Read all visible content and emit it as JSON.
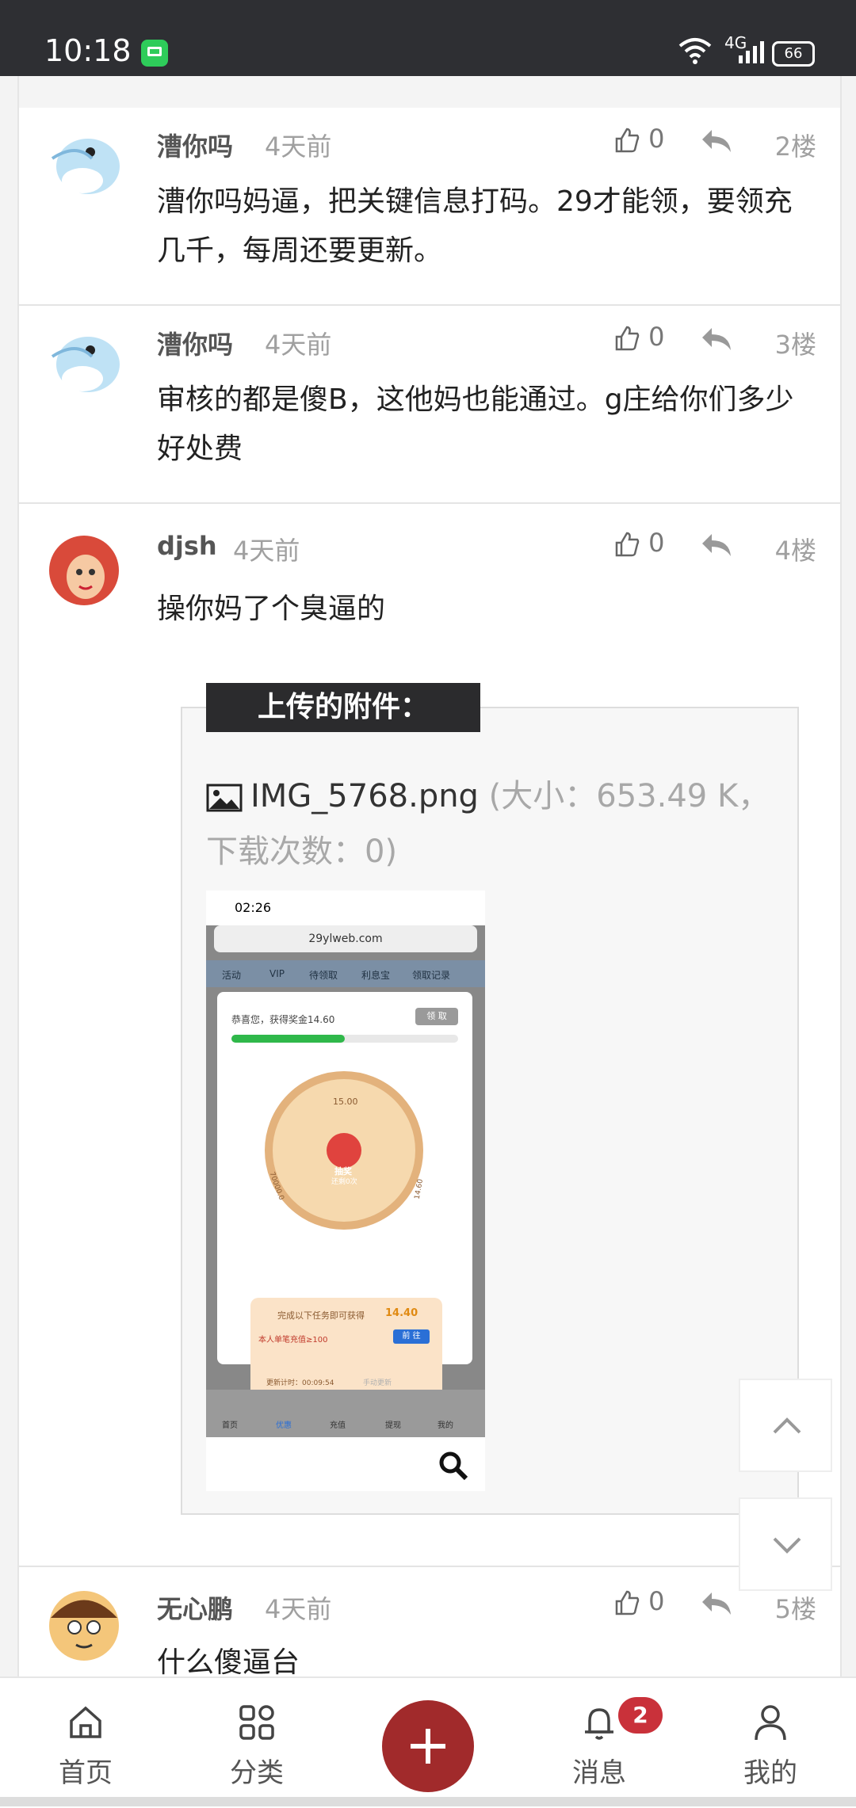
{
  "status": {
    "time": "10:18",
    "network": "4G",
    "battery": "66"
  },
  "posts": [
    {
      "user": "漕你吗",
      "time": "4天前",
      "likes": "0",
      "floor": "2楼",
      "text": "漕你吗妈逼，把关键信息打码。29才能领，要领充几千，每周还要更新。"
    },
    {
      "user": "漕你吗",
      "time": "4天前",
      "likes": "0",
      "floor": "3楼",
      "text": "审核的都是傻B，这他妈也能通过。g庄给你们多少好处费"
    },
    {
      "user": "djsh",
      "time": "4天前",
      "likes": "0",
      "floor": "4楼",
      "text": "操你妈了个臭逼的"
    },
    {
      "user": "无心鹏",
      "time": "4天前",
      "likes": "0",
      "floor": "5楼",
      "text": "什么傻逼台"
    }
  ],
  "attachment": {
    "label": "上传的附件：",
    "filename": "IMG_5768.png",
    "meta": "(大小：653.49 K，下载次数：0)"
  },
  "screenshot": {
    "time": "02:26",
    "url": "29ylweb.com",
    "tabs": [
      "活动",
      "VIP",
      "待领取",
      "利息宝",
      "领取记录"
    ],
    "popup_text": "恭喜您，获得奖金14.60",
    "popup_button": "领 取",
    "wheel_top": "15.00",
    "wheel_center": "抽奖",
    "wheel_center_sub": "还剩0次",
    "wheel_left": "70000.0",
    "wheel_right": "14.60",
    "task_title": "完成以下任务即可获得",
    "task_amount": "14.40",
    "task_line": "本人单笔充值≥100",
    "task_button": "前 往",
    "refresh_line": "更新计时：00:09:54",
    "refresh_link": "手动更新",
    "nav": [
      "首页",
      "优惠",
      "充值",
      "提现",
      "我的"
    ]
  },
  "tabbar": {
    "items": [
      {
        "label": "首页"
      },
      {
        "label": "分类"
      },
      {
        "label": "消息"
      },
      {
        "label": "我的"
      }
    ],
    "badge": "2"
  }
}
